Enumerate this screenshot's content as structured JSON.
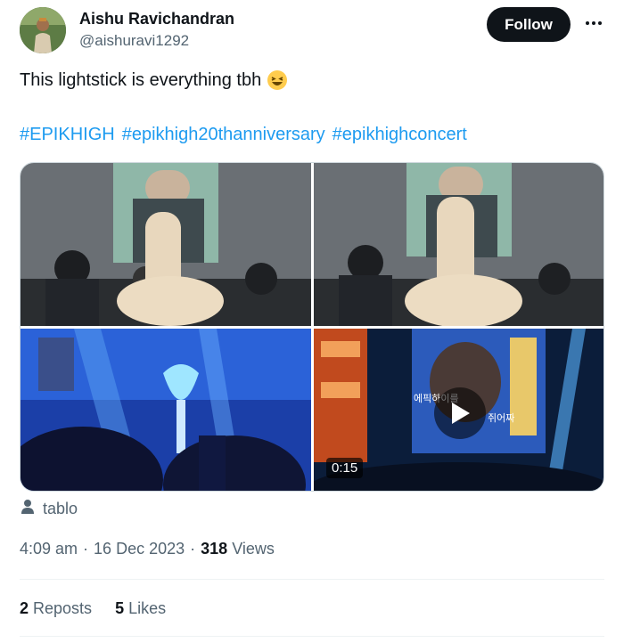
{
  "author": {
    "name": "Aishu Ravichandran",
    "handle": "@aishuravi1292"
  },
  "follow_label": "Follow",
  "tweet": {
    "text": "This lightstick is everything tbh",
    "emoji": "laughing-face",
    "hashtags": [
      "#EPIKHIGH",
      "#epikhigh20thanniversary",
      "#epikhighconcert"
    ]
  },
  "media": {
    "video_duration": "0:15",
    "video_caption_line1": "에픽하이를",
    "video_caption_line2": "쥐어짜"
  },
  "tagged_user": "tablo",
  "meta": {
    "time": "4:09 am",
    "date": "16 Dec 2023",
    "separator": "·",
    "views_count": "318",
    "views_label": "Views"
  },
  "stats": {
    "reposts_count": "2",
    "reposts_label": "Reposts",
    "likes_count": "5",
    "likes_label": "Likes"
  },
  "colors": {
    "link": "#1d9bf0",
    "text": "#0f1419",
    "secondary": "#536471",
    "button_bg": "#0f1419"
  }
}
